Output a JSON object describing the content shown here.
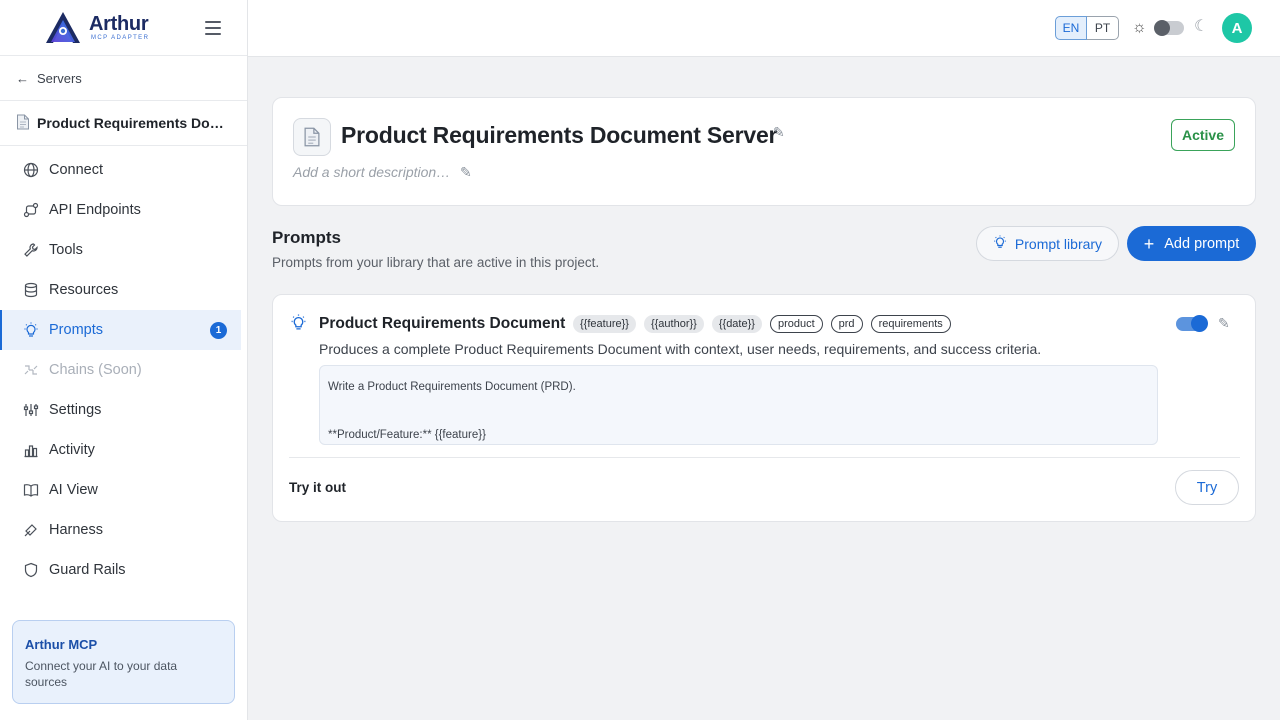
{
  "brand": {
    "name": "Arthur",
    "sub": "MCP ADAPTER"
  },
  "sidebar": {
    "back_label": "Servers",
    "server_name": "Product Requirements Docu…",
    "items": [
      {
        "label": "Connect",
        "icon": "globe-icon"
      },
      {
        "label": "API Endpoints",
        "icon": "api-endpoints-icon"
      },
      {
        "label": "Tools",
        "icon": "wrench-icon"
      },
      {
        "label": "Resources",
        "icon": "database-icon"
      },
      {
        "label": "Prompts",
        "icon": "lightbulb-icon",
        "active": true,
        "badge": "1"
      },
      {
        "label": "Chains (Soon)",
        "icon": "chains-icon",
        "disabled": true
      },
      {
        "label": "Settings",
        "icon": "sliders-icon"
      },
      {
        "label": "Activity",
        "icon": "bar-chart-icon"
      },
      {
        "label": "AI View",
        "icon": "book-icon"
      },
      {
        "label": "Harness",
        "icon": "harness-icon"
      },
      {
        "label": "Guard Rails",
        "icon": "shield-icon"
      }
    ],
    "promo": {
      "title": "Arthur MCP",
      "text": "Connect your AI to your data sources"
    }
  },
  "topbar": {
    "lang_en": "EN",
    "lang_pt": "PT",
    "avatar_initial": "A"
  },
  "server": {
    "title": "Product Requirements Document Server",
    "description_placeholder": "Add a short description…",
    "status": "Active"
  },
  "prompts_section": {
    "title": "Prompts",
    "subtitle": "Prompts from your library that are active in this project.",
    "library_button": "Prompt library",
    "add_button": "Add prompt"
  },
  "prompt": {
    "title": "Product Requirements Document",
    "variables": [
      "{{feature}}",
      "{{author}}",
      "{{date}}"
    ],
    "keywords": [
      "product",
      "prd",
      "requirements"
    ],
    "description": "Produces a complete Product Requirements Document with context, user needs, requirements, and success criteria.",
    "body_line1": "Write a Product Requirements Document (PRD).",
    "body_line2": "**Product/Feature:** {{feature}}",
    "try_label": "Try it out",
    "try_button": "Try"
  },
  "colors": {
    "accent": "#1b6ad6",
    "active_status": "#2a9148",
    "avatar": "#1ec7a6"
  }
}
